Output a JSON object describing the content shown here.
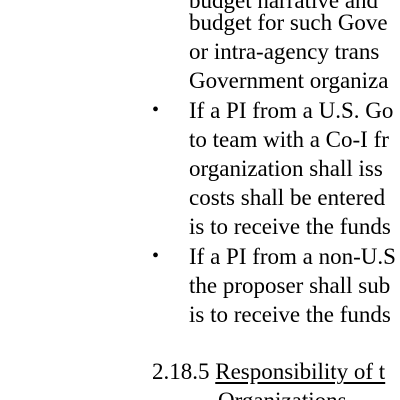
{
  "document": {
    "first_paragraph_lines": [
      "budget narrative and",
      "budget for such Gove",
      "or  intra-agency  trans",
      "Government organiza"
    ],
    "bullets": [
      {
        "symbol": "•",
        "lines": [
          "If a PI from a U.S. Go",
          "to team with a Co-I fr",
          "organization shall iss",
          "costs shall be entered",
          "is to receive the funds"
        ]
      },
      {
        "symbol": "•",
        "lines": [
          "If a PI from a non-U.S",
          "the proposer shall sub",
          "is to receive the funds"
        ]
      }
    ],
    "section": {
      "number": "2.18.5",
      "title_line1": "Responsibility of t",
      "title_line2": "Organizations"
    }
  }
}
